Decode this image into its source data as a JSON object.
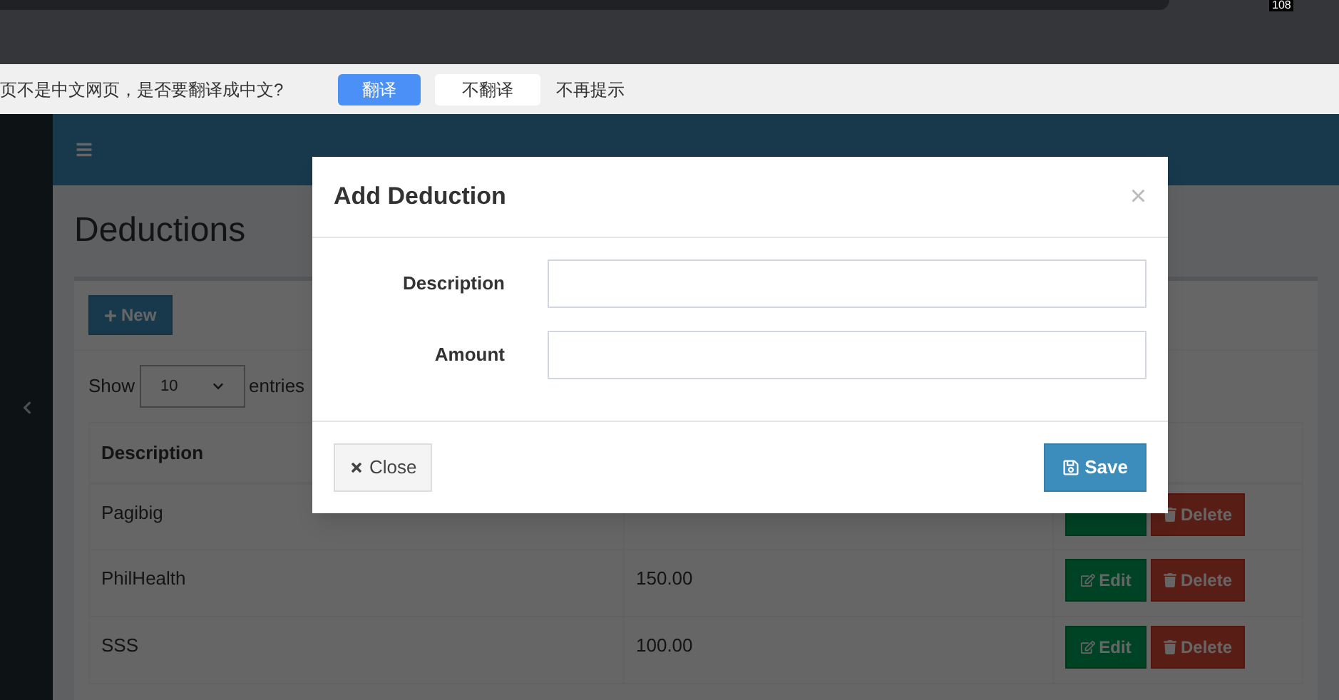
{
  "browser": {
    "badge": "108"
  },
  "translate_bar": {
    "message": "页不是中文网页，是否要翻译成中文?",
    "buttons": [
      {
        "label": "翻译",
        "kind": "primary"
      },
      {
        "label": "不翻译",
        "kind": "plain"
      }
    ],
    "dismiss": "不再提示"
  },
  "page": {
    "title": "Deductions",
    "new_button": "New",
    "show_label": "Show",
    "entries_select": "10",
    "entries_label": "entries",
    "table": {
      "columns": [
        "Description"
      ],
      "rows": [
        {
          "description": "Pagibig",
          "delete": "Delete"
        },
        {
          "description": "PhilHealth",
          "amount": "150.00",
          "edit": "Edit",
          "delete": "Delete"
        },
        {
          "description": "SSS",
          "amount": "100.00",
          "edit": "Edit",
          "delete": "Delete"
        }
      ]
    }
  },
  "modal": {
    "title": "Add Deduction",
    "close_mark": "×",
    "fields": [
      {
        "label": "Description"
      },
      {
        "label": "Amount"
      }
    ],
    "close_button": "Close",
    "save_button": "Save"
  }
}
